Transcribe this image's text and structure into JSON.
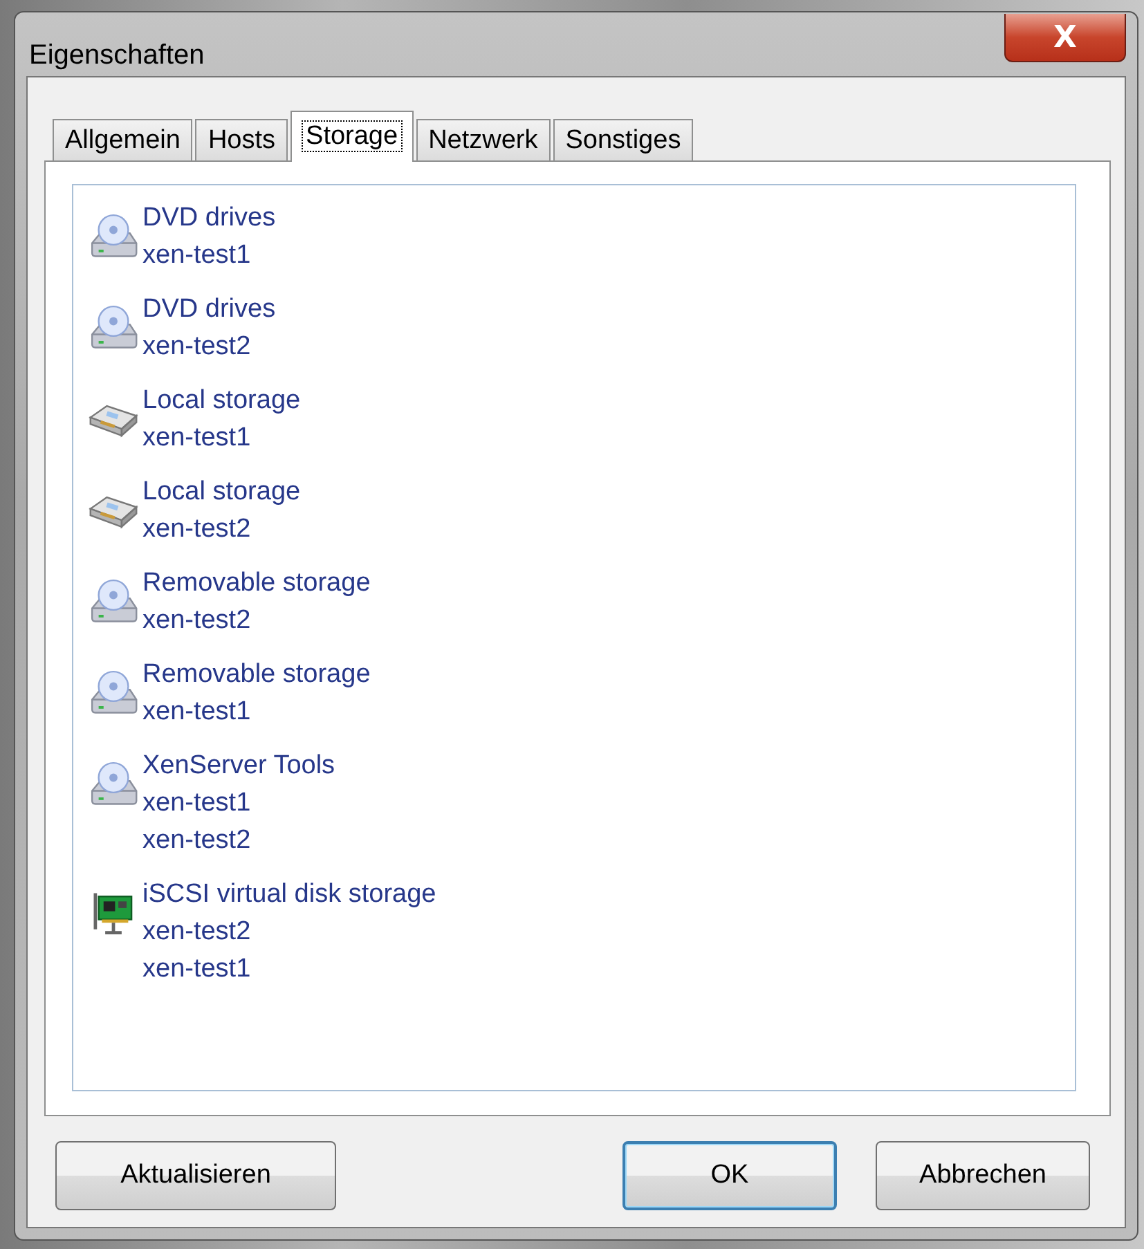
{
  "window": {
    "title": "Eigenschaften",
    "close": "X"
  },
  "tabs": [
    {
      "label": "Allgemein",
      "selected": false
    },
    {
      "label": "Hosts",
      "selected": false
    },
    {
      "label": "Storage",
      "selected": true
    },
    {
      "label": "Netzwerk",
      "selected": false
    },
    {
      "label": "Sonstiges",
      "selected": false
    }
  ],
  "storage": [
    {
      "kind": "dvd",
      "name": "DVD drives",
      "hosts": [
        "xen-test1"
      ]
    },
    {
      "kind": "dvd",
      "name": "DVD drives",
      "hosts": [
        "xen-test2"
      ]
    },
    {
      "kind": "disk",
      "name": "Local storage",
      "hosts": [
        "xen-test1"
      ]
    },
    {
      "kind": "disk",
      "name": "Local storage",
      "hosts": [
        "xen-test2"
      ]
    },
    {
      "kind": "dvd",
      "name": "Removable storage",
      "hosts": [
        "xen-test2"
      ]
    },
    {
      "kind": "dvd",
      "name": "Removable storage",
      "hosts": [
        "xen-test1"
      ]
    },
    {
      "kind": "dvd",
      "name": "XenServer Tools",
      "hosts": [
        "xen-test1",
        "xen-test2"
      ]
    },
    {
      "kind": "nic",
      "name": "iSCSI virtual disk storage",
      "hosts": [
        "xen-test2",
        "xen-test1"
      ]
    }
  ],
  "buttons": [
    {
      "label": "Aktualisieren",
      "kind": "normal"
    },
    {
      "label": "OK",
      "kind": "default"
    },
    {
      "label": "Abbrechen",
      "kind": "normal"
    }
  ]
}
